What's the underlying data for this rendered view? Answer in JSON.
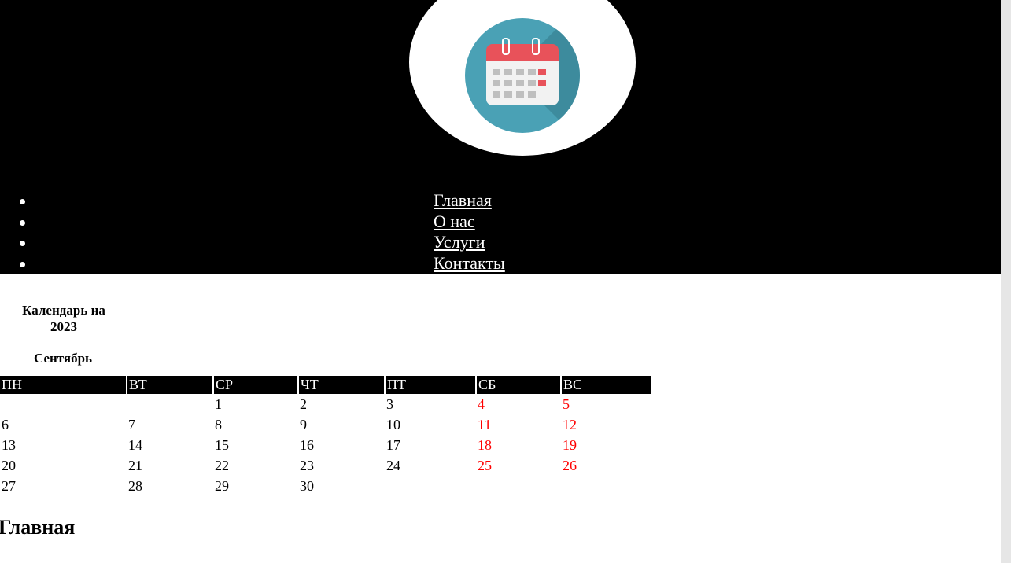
{
  "nav": {
    "items": [
      {
        "label": "Главная"
      },
      {
        "label": "О нас"
      },
      {
        "label": "Услуги"
      },
      {
        "label": "Контакты"
      }
    ]
  },
  "calendar": {
    "title": "Календарь на 2023",
    "month": "Сентябрь",
    "weekdays": [
      "ПН",
      "ВТ",
      "СР",
      "ЧТ",
      "ПТ",
      "СБ",
      "ВС"
    ],
    "weeks": [
      [
        "",
        "",
        "1",
        "2",
        "3",
        "4",
        "5"
      ],
      [
        "6",
        "7",
        "8",
        "9",
        "10",
        "11",
        "12"
      ],
      [
        "13",
        "14",
        "15",
        "16",
        "17",
        "18",
        "19"
      ],
      [
        "20",
        "21",
        "22",
        "23",
        "24",
        "25",
        "26"
      ],
      [
        "27",
        "28",
        "29",
        "30",
        "",
        "",
        ""
      ]
    ],
    "weekend_color": "#ff0000"
  },
  "page": {
    "heading": "Главная"
  },
  "colors": {
    "header_bg": "#000000",
    "logo_circle": "#4aa1b5",
    "calendar_icon_red": "#e8525a"
  },
  "icons": {
    "logo": "calendar-icon"
  }
}
